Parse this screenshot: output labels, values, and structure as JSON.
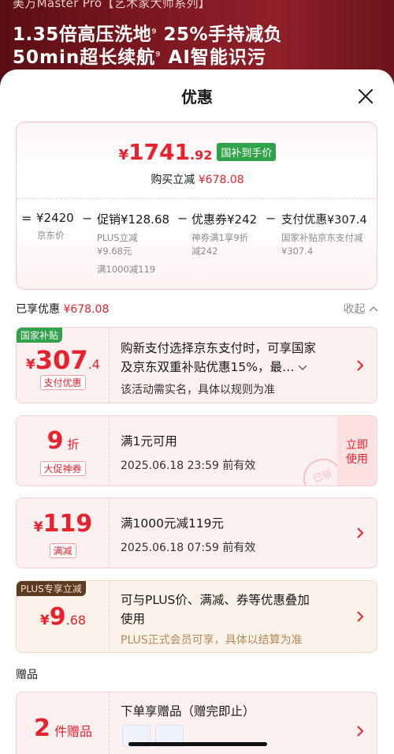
{
  "banner": {
    "top_line": "美万Master Pro【艺术家大师系列】",
    "line1": "1.35倍高压洗地",
    "line1_b": "25%手持减负",
    "line2": "50min超长续航",
    "line2_b": "AI智能识污",
    "footnote_mark": "9"
  },
  "sheet": {
    "title": "优惠"
  },
  "summary": {
    "final_yen": "¥",
    "final_int": "1741",
    "final_dec": ".92",
    "final_badge": "国补到手价",
    "reduce_label": "购买立减",
    "reduce_amount": "¥678.08",
    "formula": {
      "eq": "=",
      "jd_price": "¥2420",
      "jd_price_label": "京东价",
      "minus": "−",
      "promo": "促销¥128.68",
      "promo_sub1": "PLUS立减",
      "promo_sub2": "¥9.68元",
      "promo_sub3": "满1000减119",
      "coupon": "优惠券¥242",
      "coupon_sub1": "神券满1享9折",
      "coupon_sub2": "减242",
      "pay": "支付优惠¥307.4",
      "pay_sub1": "国家补贴京东支付减",
      "pay_sub2": "¥307.4"
    }
  },
  "enjoyed": {
    "label": "已享优惠",
    "amount": "¥678.08",
    "collapse": "收起"
  },
  "coupons": {
    "c1": {
      "corner": "国家补贴",
      "yen": "¥",
      "int": "307",
      "dec": ".4",
      "tag": "支付优惠",
      "line1": "购新支付选择京东支付时，可享国家",
      "line2": "及京东双重补贴优惠15%，最…",
      "sub": "该活动需实名，具体以规则为准"
    },
    "c2": {
      "value": "9",
      "unit": "折",
      "tag": "大促神券",
      "title": "满1元可用",
      "valid": "2025.06.18 23:59 前有效",
      "button_l1": "立即",
      "button_l2": "使用",
      "stamp": "已领"
    },
    "c3": {
      "yen": "¥",
      "value": "119",
      "tag": "满减",
      "title": "满1000元减119元",
      "valid": "2025.06.18 07:59 前有效"
    },
    "c4": {
      "corner": "PLUS专享立减",
      "yen": "¥",
      "int": "9",
      "dec": ".68",
      "line1": "可与PLUS价、满减、券等优惠叠加",
      "line2": "使用",
      "sub": "PLUS正式会员可享，具体以结算为准"
    }
  },
  "gifts": {
    "label": "赠品",
    "count": "2",
    "unit": "件赠品",
    "title": "下单享赠品（赠完即止）"
  },
  "colors": {
    "accent_red": "#e8212c",
    "green_badge": "#2fa24a",
    "plus_brown": "#5b3c22"
  }
}
